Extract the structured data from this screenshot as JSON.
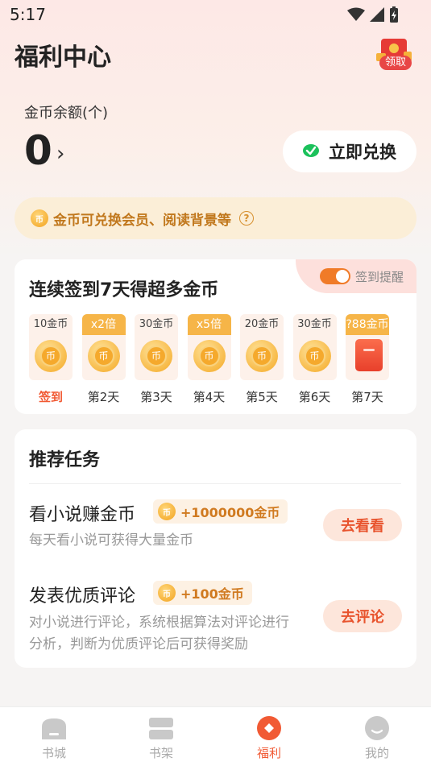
{
  "status": {
    "time": "5:17"
  },
  "header": {
    "title": "福利中心",
    "gift_label": "领取"
  },
  "balance": {
    "label": "金币余额(个)",
    "value": "0",
    "arrow": "›"
  },
  "exchange": {
    "label": "立即兑换"
  },
  "notice": {
    "coin_glyph": "币",
    "text": "金币可兑换会员、阅读背景等",
    "help_glyph": "?"
  },
  "checkin": {
    "title": "连续签到7天得超多金币",
    "reminder_label": "签到提醒",
    "reminder_on": true,
    "days": [
      {
        "top": "10金币",
        "badge": false,
        "label": "签到",
        "active": true
      },
      {
        "top": "x2倍",
        "badge": true,
        "label": "第2天"
      },
      {
        "top": "30金币",
        "badge": false,
        "label": "第3天"
      },
      {
        "top": "x5倍",
        "badge": true,
        "label": "第4天"
      },
      {
        "top": "20金币",
        "badge": false,
        "label": "第5天"
      },
      {
        "top": "30金币",
        "badge": false,
        "label": "第6天"
      },
      {
        "top": "?88金币",
        "badge": true,
        "label": "第7天",
        "redpack": true
      }
    ],
    "coin_glyph": "币"
  },
  "tasks": {
    "title": "推荐任务",
    "items": [
      {
        "name": "看小说赚金币",
        "reward": "+1000000金币",
        "desc": "每天看小说可获得大量金币",
        "button": "去看看"
      },
      {
        "name": "发表优质评论",
        "reward": "+100金币",
        "desc_line1": "对小说进行评论，系统根据算法对评论进行",
        "desc_line2": "分析，判断为优质评论后可获得奖励",
        "button": "去评论"
      }
    ]
  },
  "tabbar": {
    "items": [
      {
        "label": "书城",
        "icon": "bookstore-icon"
      },
      {
        "label": "书架",
        "icon": "bookshelf-icon"
      },
      {
        "label": "福利",
        "icon": "welfare-icon",
        "active": true
      },
      {
        "label": "我的",
        "icon": "profile-icon"
      }
    ]
  },
  "colors": {
    "accent": "#f15a34",
    "gold": "#f4a824",
    "wechat": "#1bc15b"
  }
}
